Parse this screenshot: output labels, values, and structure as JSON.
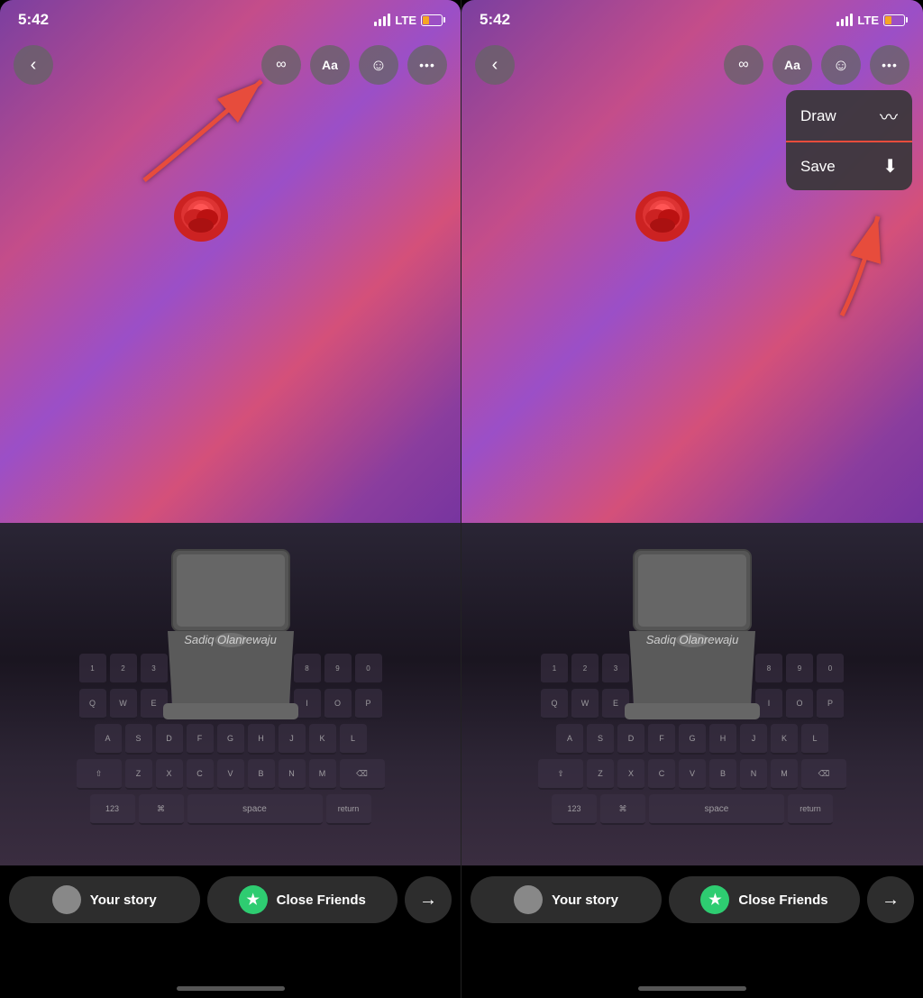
{
  "screens": [
    {
      "id": "screen-left",
      "statusBar": {
        "time": "5:42",
        "lte": "LTE"
      },
      "toolbar": {
        "backLabel": "‹",
        "infinityLabel": "∞",
        "textLabel": "Aa",
        "stickerLabel": "☺",
        "moreLabel": "•••"
      },
      "watermark": "Sadiq Olanrewaju",
      "bottomBar": {
        "yourStoryLabel": "Your story",
        "closeFriendsLabel": "Close Friends",
        "sendLabel": "→"
      },
      "hasDropdown": false,
      "hasArrow": true
    },
    {
      "id": "screen-right",
      "statusBar": {
        "time": "5:42",
        "lte": "LTE"
      },
      "toolbar": {
        "backLabel": "‹",
        "infinityLabel": "∞",
        "textLabel": "Aa",
        "stickerLabel": "☺",
        "moreLabel": "•••"
      },
      "watermark": "Sadiq Olanrewaju",
      "dropdown": {
        "drawLabel": "Draw",
        "drawIcon": "〰",
        "saveLabel": "Save",
        "saveIcon": "⬇"
      },
      "bottomBar": {
        "yourStoryLabel": "Your story",
        "closeFriendsLabel": "Close Friends",
        "sendLabel": "→"
      },
      "hasDropdown": true,
      "hasArrow": true
    }
  ]
}
